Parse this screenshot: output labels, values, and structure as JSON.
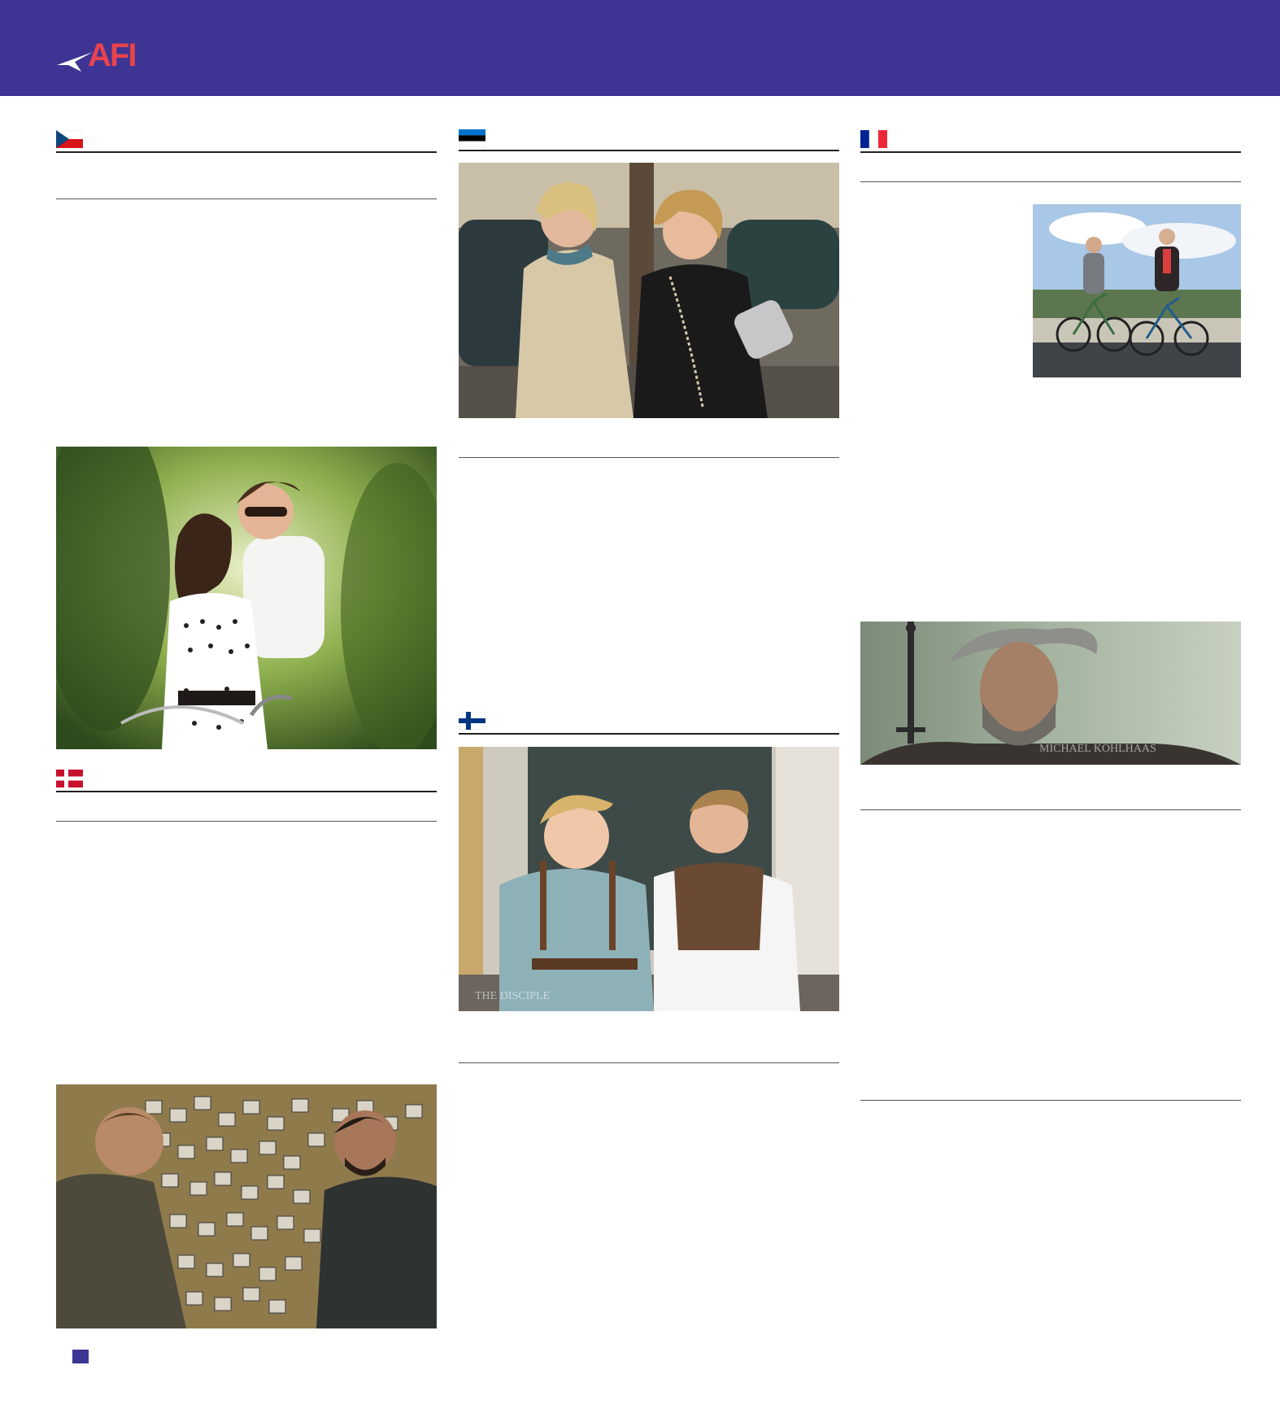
{
  "header": {
    "logo_text": "AFI",
    "brand_color": "#3d3494",
    "logo_color": "#e8434d"
  },
  "sections": {
    "czech": {
      "flag": "czech-flag"
    },
    "denmark": {
      "flag": "denmark-flag"
    },
    "estonia": {
      "flag": "estonia-flag"
    },
    "finland": {
      "flag": "finland-flag"
    },
    "france": {
      "flag": "france-flag"
    }
  },
  "photos": {
    "estonia_caption": "",
    "finland_caption": "THE DISCIPLE",
    "france_kohlhaas_caption": "MICHAEL KOHLHAAS"
  }
}
